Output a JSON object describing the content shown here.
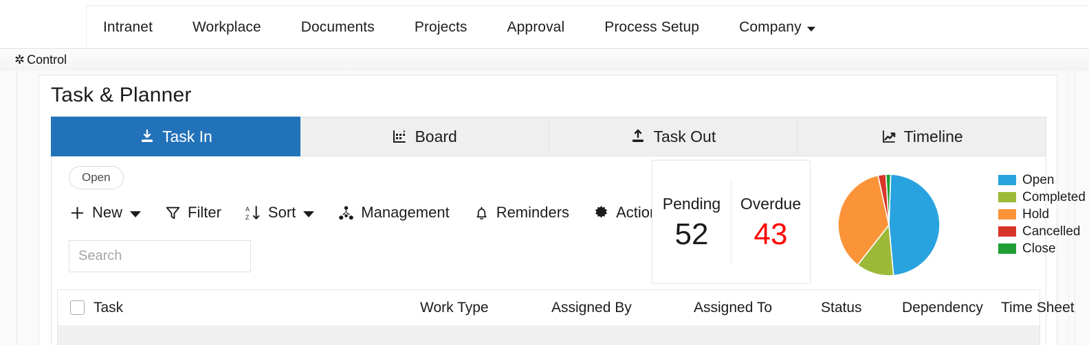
{
  "nav": {
    "items": [
      {
        "label": "Intranet",
        "has_caret": false
      },
      {
        "label": "Workplace",
        "has_caret": false
      },
      {
        "label": "Documents",
        "has_caret": false
      },
      {
        "label": "Projects",
        "has_caret": false
      },
      {
        "label": "Approval",
        "has_caret": false
      },
      {
        "label": "Process Setup",
        "has_caret": false
      },
      {
        "label": "Company",
        "has_caret": true
      }
    ]
  },
  "control_bar": {
    "label": "Control",
    "icon": "gear-icon"
  },
  "page": {
    "title": "Task & Planner"
  },
  "tabs": [
    {
      "label": "Task In",
      "icon": "download-icon",
      "active": true
    },
    {
      "label": "Board",
      "icon": "board-icon",
      "active": false
    },
    {
      "label": "Task Out",
      "icon": "upload-icon",
      "active": false
    },
    {
      "label": "Timeline",
      "icon": "line-chart-icon",
      "active": false
    }
  ],
  "status_chip": {
    "label": "Open"
  },
  "toolbar": [
    {
      "label": "New",
      "icon": "plus-icon",
      "caret": true
    },
    {
      "label": "Filter",
      "icon": "funnel-icon",
      "caret": false
    },
    {
      "label": "Sort",
      "icon": "sort-az-icon",
      "caret": true
    },
    {
      "label": "Management",
      "icon": "org-chart-icon",
      "caret": false
    },
    {
      "label": "Reminders",
      "icon": "bell-icon",
      "caret": false
    },
    {
      "label": "Action",
      "icon": "gear-icon",
      "caret": true
    }
  ],
  "search": {
    "placeholder": "Search",
    "value": ""
  },
  "stats": {
    "pending": {
      "label": "Pending",
      "value": "52"
    },
    "overdue": {
      "label": "Overdue",
      "value": "43"
    }
  },
  "chart_data": {
    "type": "pie",
    "title": "",
    "legend_position": "right",
    "categories": [
      "Open",
      "Completed",
      "Hold",
      "Cancelled",
      "Close"
    ],
    "values": [
      48,
      12,
      36,
      2.5,
      1.5
    ],
    "colors": [
      "#29a3e0",
      "#9cb938",
      "#fb9339",
      "#d8352a",
      "#1f9e35"
    ],
    "units": "percent"
  },
  "table": {
    "select_all": "select-all-checkbox",
    "columns": [
      {
        "label": "Task"
      },
      {
        "label": "Work Type"
      },
      {
        "label": "Assigned By"
      },
      {
        "label": "Assigned To"
      },
      {
        "label": "Status"
      },
      {
        "label": "Dependency"
      },
      {
        "label": "Time Sheet"
      }
    ]
  },
  "theme": {
    "accent": "#2272b9",
    "alert": "#ff0000",
    "tab_inactive_bg": "#efefef",
    "page_bg": "#fafafa"
  }
}
